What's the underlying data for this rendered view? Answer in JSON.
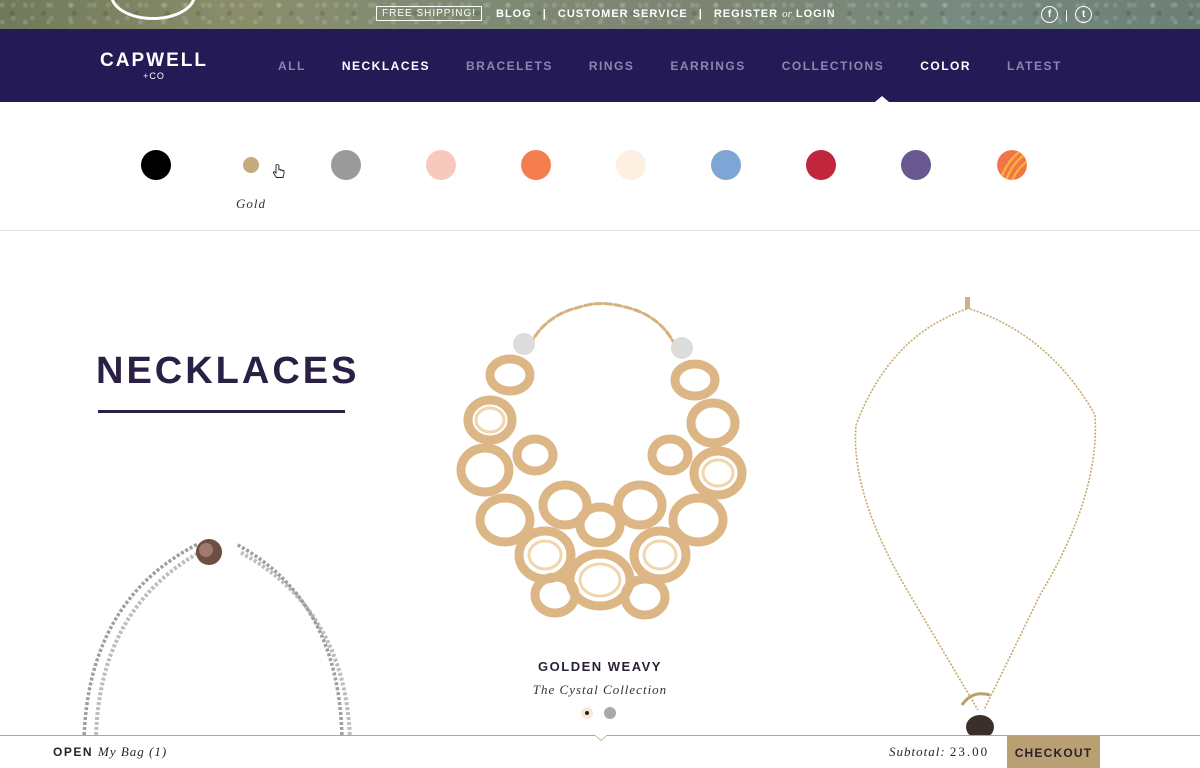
{
  "topbar": {
    "free_shipping": "FREE SHIPPING!",
    "blog": "BLOG",
    "customer_service": "CUSTOMER SERVICE",
    "register": "REGISTER",
    "or": "or",
    "login": "LOGIN",
    "separator": "|",
    "social": {
      "facebook_glyph": "f",
      "twitter_glyph": "t",
      "separator": "|"
    }
  },
  "brand": {
    "name": "CAPWELL",
    "sub": "+CO"
  },
  "nav": {
    "items": [
      {
        "label": "ALL",
        "bright": false
      },
      {
        "label": "NECKLACES",
        "bright": true
      },
      {
        "label": "BRACELETS",
        "bright": false
      },
      {
        "label": "RINGS",
        "bright": false
      },
      {
        "label": "EARRINGS",
        "bright": false
      },
      {
        "label": "COLLECTIONS",
        "bright": false
      },
      {
        "label": "COLOR",
        "bright": true,
        "active": true
      },
      {
        "label": "LATEST",
        "bright": false
      }
    ]
  },
  "colors": {
    "hovered_label": "Gold",
    "swatches": [
      {
        "hex": "#000000"
      },
      {
        "hex": "#c4aa7c",
        "hovered": true
      },
      {
        "hex": "#9a9a9a"
      },
      {
        "hex": "#f7c9bc"
      },
      {
        "hex": "#f47e4e"
      },
      {
        "hex": "#fdefe2"
      },
      {
        "hex": "#7fa5d6"
      },
      {
        "hex": "#c0273b"
      },
      {
        "hex": "#6a5890"
      },
      {
        "hex": "#f2754a",
        "pattern": "striped"
      }
    ]
  },
  "category": {
    "title": "NECKLACES"
  },
  "featured_product": {
    "name": "GOLDEN WEAVY",
    "collection": "The Cystal Collection",
    "carousel_index": 1,
    "carousel_count": 2
  },
  "bag": {
    "open_label": "OPEN",
    "bag_label": "My Bag (1)",
    "subtotal_label": "Subtotal:",
    "subtotal_value": "23.00",
    "checkout_label": "CHECKOUT"
  },
  "theme": {
    "nav_bg": "#241a55",
    "heading": "#2a1f45",
    "accent_gold": "#b8a073"
  }
}
